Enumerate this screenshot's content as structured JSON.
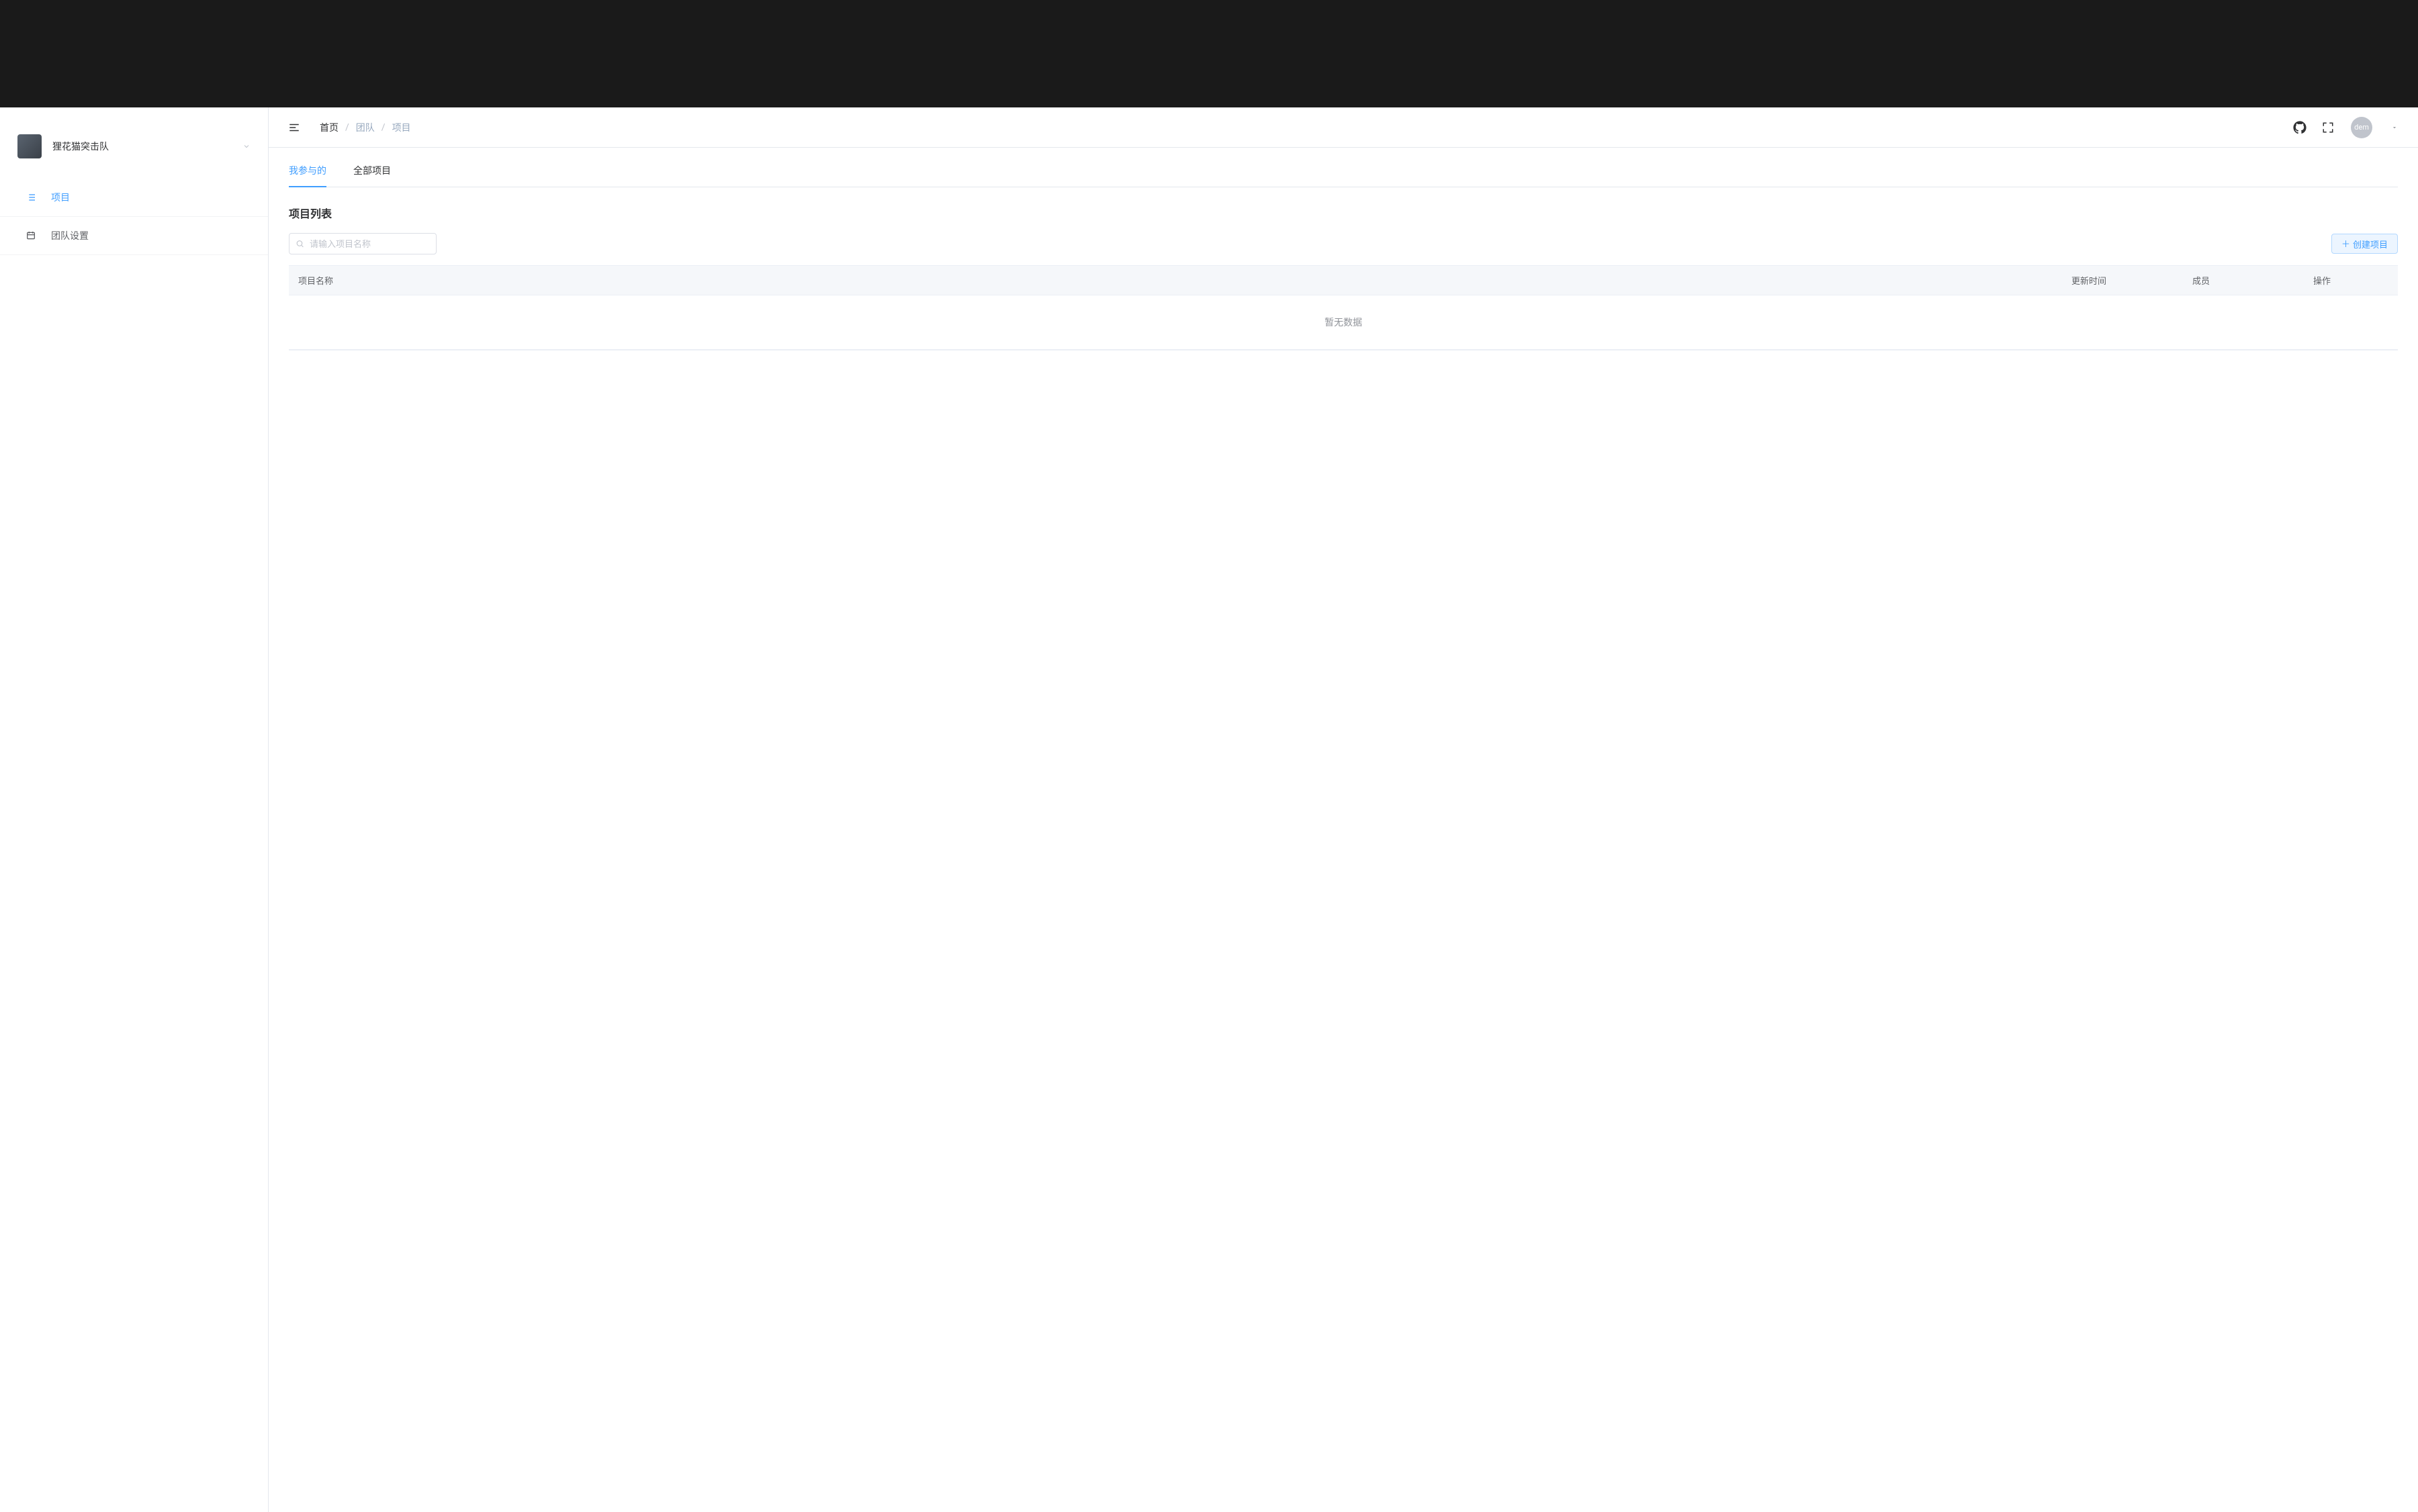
{
  "sidebar": {
    "team_name": "狸花猫突击队",
    "items": [
      {
        "label": "项目",
        "active": true
      },
      {
        "label": "团队设置",
        "active": false
      }
    ]
  },
  "header": {
    "breadcrumb": [
      {
        "label": "首页",
        "muted": false
      },
      {
        "label": "团队",
        "muted": true
      },
      {
        "label": "项目",
        "muted": true
      }
    ],
    "user_avatar_text": "dem"
  },
  "tabs": [
    {
      "label": "我参与的",
      "active": true
    },
    {
      "label": "全部项目",
      "active": false
    }
  ],
  "section_title": "项目列表",
  "search": {
    "placeholder": "请输入项目名称",
    "value": ""
  },
  "create_button_label": "创建项目",
  "table": {
    "columns": {
      "name": "项目名称",
      "update_time": "更新时间",
      "member": "成员",
      "action": "操作"
    },
    "empty_text": "暂无数据"
  }
}
